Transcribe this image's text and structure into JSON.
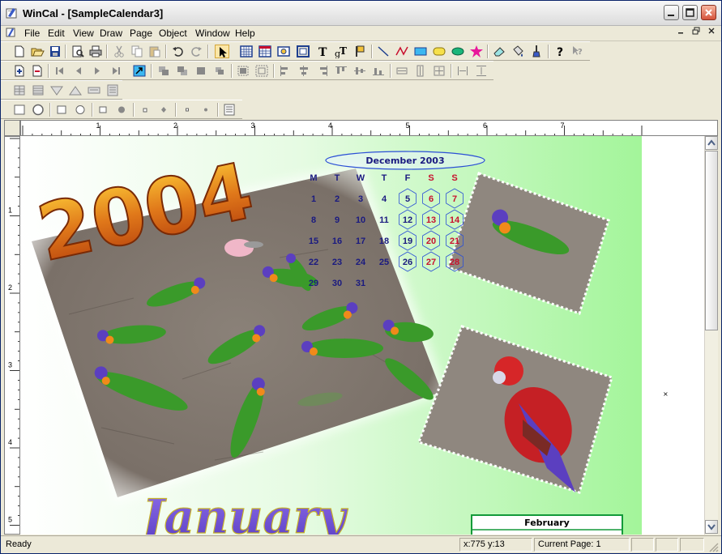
{
  "window": {
    "title": "WinCal - [SampleCalendar3]"
  },
  "menu": [
    "File",
    "Edit",
    "View",
    "Draw",
    "Page",
    "Object",
    "Window",
    "Help"
  ],
  "toolbar1": [
    "new-icon",
    "open-icon",
    "save-icon",
    "print-preview-icon",
    "print-icon",
    "cut-icon",
    "copy-icon",
    "paste-icon",
    "undo-icon",
    "redo-icon",
    "select-arrow-icon",
    "calendar-grid-icon",
    "calendar-month-icon",
    "picture-icon",
    "frame-icon",
    "text-icon",
    "text-style-icon",
    "flag-icon",
    "line-icon",
    "curve-icon",
    "rectangle-icon",
    "rounded-rect-icon",
    "ellipse-icon",
    "star-icon",
    "eraser-icon",
    "fill-icon",
    "brush-icon",
    "help-icon",
    "context-help-icon"
  ],
  "toolbar2": [
    "add-page-icon",
    "first-page-icon",
    "prev-page-icon",
    "next-page-icon",
    "last-page-icon",
    "goto-page-icon",
    "bring-front-icon",
    "send-back-icon",
    "forward-icon",
    "backward-icon",
    "group-icon",
    "ungroup-icon",
    "align-left-icon",
    "align-center-icon",
    "align-right-icon",
    "align-top-icon",
    "align-middle-icon",
    "align-bottom-icon",
    "same-width-icon",
    "same-height-icon",
    "same-size-icon",
    "space-horizontal-icon",
    "space-vertical-icon"
  ],
  "toolbar3": [
    "table-icon",
    "grid-icon",
    "triangle-down-icon",
    "triangle-up-icon",
    "keyboard-icon",
    "form-icon"
  ],
  "toolbar4": [
    "square-icon",
    "circle-icon",
    "small-square-icon",
    "small-circle-icon",
    "dot-square-icon",
    "dot-circle-icon",
    "tiny-square-icon",
    "tiny-diamond-icon",
    "mini-square-icon",
    "mini-dot-icon",
    "list-icon"
  ],
  "ruler": {
    "h_labels": [
      "1",
      "2",
      "3",
      "4",
      "5",
      "6",
      "7"
    ],
    "v_labels": [
      "1",
      "2",
      "3",
      "4",
      "5"
    ]
  },
  "calendar": {
    "year_text": "2004",
    "month_text": "January",
    "mini_month": "December 2003",
    "weekdays": [
      "M",
      "T",
      "W",
      "T",
      "F",
      "S",
      "S"
    ],
    "weeks": [
      [
        "1",
        "2",
        "3",
        "4",
        "5",
        "6",
        "7"
      ],
      [
        "8",
        "9",
        "10",
        "11",
        "12",
        "13",
        "14"
      ],
      [
        "15",
        "16",
        "17",
        "18",
        "19",
        "20",
        "21"
      ],
      [
        "22",
        "23",
        "24",
        "25",
        "26",
        "27",
        "28"
      ],
      [
        "29",
        "30",
        "31",
        "",
        "",
        "",
        ""
      ]
    ],
    "next_month_label": "February",
    "colors": {
      "weekday": "#1a1a80",
      "weekend": "#c8102e",
      "header_outline": "#2b4fd6",
      "gradient_green": "#a3f59a"
    }
  },
  "status": {
    "ready": "Ready",
    "coords": "x:775  y:13",
    "page": "Current Page: 1"
  }
}
